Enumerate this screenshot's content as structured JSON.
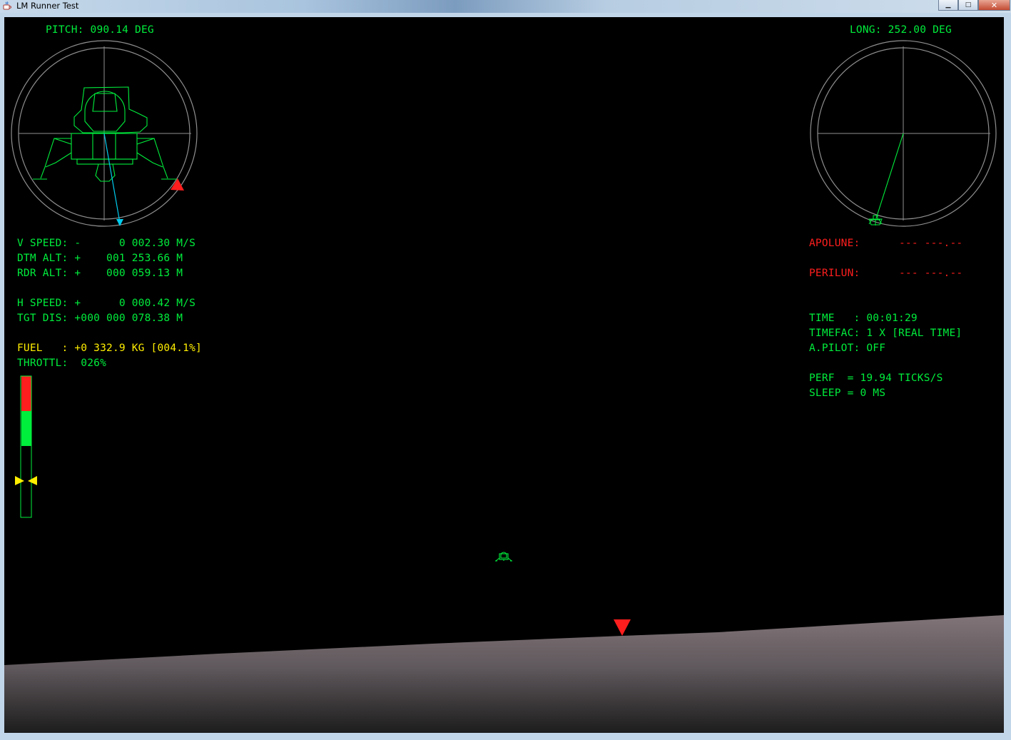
{
  "window": {
    "title": "LM Runner Test",
    "icons": {
      "app": "java-icon",
      "minimize": "minimize-icon",
      "maximize": "maximize-icon",
      "close": "close-icon"
    },
    "controls": {
      "minimize": "▁",
      "maximize": "□",
      "close": "✕"
    }
  },
  "left_gauge": {
    "label": "PITCH: 090.14 DEG"
  },
  "right_gauge": {
    "label": "LONG: 252.00 DEG"
  },
  "telemetry": {
    "v_speed": "V SPEED: -      0 002.30 M/S",
    "dtm_alt": "DTM ALT: +    001 253.66 M",
    "rdr_alt": "RDR ALT: +    000 059.13 M",
    "h_speed": "H SPEED: +      0 000.42 M/S",
    "tgt_dis": "TGT DIS: +000 000 078.38 M",
    "fuel": "FUEL   : +0 332.9 KG [004.1%]",
    "throttle": "THROTTL:  026%",
    "throttle_level": 0.26
  },
  "orbit": {
    "apolune_label": "APOLUNE:",
    "apolune_value": "--- ---.--",
    "perilune_label": "PERILUN:",
    "perilune_value": "--- ---.--"
  },
  "status": {
    "time": "TIME   : 00:01:29",
    "timefac": "TIMEFAC: 1 X [REAL TIME]",
    "apilot": "A.PILOT: OFF",
    "perf": "PERF  = 19.94 TICKS/S",
    "sleep": "SLEEP = 0 MS"
  },
  "colors": {
    "hud_green": "#00ee3c",
    "fuel_yellow": "#ffee00",
    "warning_red": "#ff1e1e",
    "vector_cyan": "#00ccee",
    "terrain": "#7e7279"
  }
}
